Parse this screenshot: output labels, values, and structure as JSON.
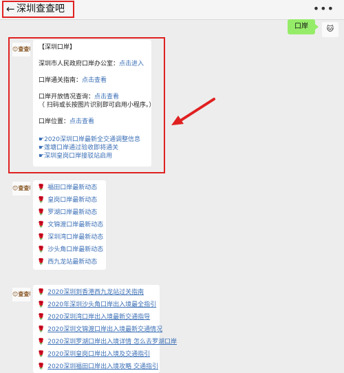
{
  "header": {
    "back_icon": "←",
    "title": "深圳查查吧",
    "more_icon": "•••"
  },
  "sent": {
    "text": "口岸"
  },
  "avatars": {
    "bot": "😊查查吧",
    "user": "🐱"
  },
  "msg1": {
    "heading": "【深圳口岸】",
    "office_label": "深圳市人民政府口岸办公室：",
    "office_link": "点击进入",
    "guide_label": "口岸通关指南：",
    "guide_link": "点击查看",
    "status_label": "口岸开放情况查询：",
    "status_link": "点击查看",
    "status_note": "（ 扫码或长按图片识别即可启用小程序。）",
    "location_label": "口岸位置：",
    "location_link": "点击查看",
    "news": [
      "☛2020深圳口岸最新全交通调整信息",
      "☛莲塘口岸通过验收即将通关",
      "☛深圳皇岗口岸接驳站启用"
    ]
  },
  "msg2": {
    "rose_icon": "🌹",
    "items": [
      "福田口岸最新动态",
      "皇岗口岸最新动态",
      "罗湖口岸最新动态",
      "文锦渡口岸最新动态",
      "深圳湾口岸最新动态",
      "沙头角口岸最新动态",
      "西九龙站最新动态"
    ]
  },
  "msg3": {
    "items": [
      "2020深圳到香港西九龙站过关指南",
      "2020年深圳沙头角口岸出入境最全指引",
      "2020深圳湾口岸出入境最新交通指导",
      "2020深圳文锦渡口岸出入境最新交通情况",
      "2020深圳罗湖口岸出入境详情 怎么去罗湖口岸",
      "2020深圳皇岗口岸出入境及交通指引",
      "2020深圳福田口岸出入境攻略 交通指引"
    ]
  },
  "colors": {
    "highlight": "#e02020",
    "link": "#3b6fb6",
    "bubble_green": "#95ec69"
  }
}
